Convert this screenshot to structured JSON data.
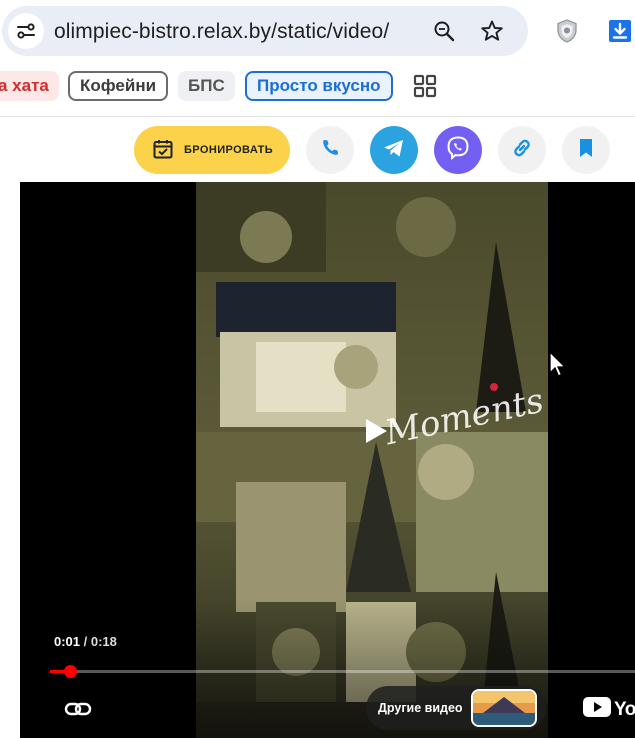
{
  "browser": {
    "url": "olimpiec-bistro.relax.by/static/video/",
    "icons": [
      "site-info-icon",
      "zoom-icon",
      "star-icon",
      "shield-extension-icon",
      "download-icon"
    ]
  },
  "bookmarks": {
    "items": [
      {
        "label": "а хата",
        "style": "red"
      },
      {
        "label": "Кофейни",
        "style": "outline"
      },
      {
        "label": "БПС",
        "style": "grey"
      },
      {
        "label": "Просто вкусно",
        "style": "blue"
      }
    ],
    "apps_icon": "apps-grid-icon"
  },
  "actions": {
    "book_label": "БРОНИРОВАТЬ",
    "colors": {
      "book": "#fbd24a",
      "telegram": "#2aa3e0",
      "viber": "#7360f2",
      "accent": "#1a8fe3"
    },
    "buttons": [
      "phone-icon",
      "telegram-icon",
      "viber-icon",
      "link-icon",
      "bookmark-icon"
    ]
  },
  "player": {
    "current_time": "0:01",
    "separator": " / ",
    "duration": "0:18",
    "progress_fraction": 0.034,
    "overlay_text": "Moments",
    "more_videos_label": "Другие видео",
    "brand_text": "You",
    "progress_color": "#ff0000"
  }
}
